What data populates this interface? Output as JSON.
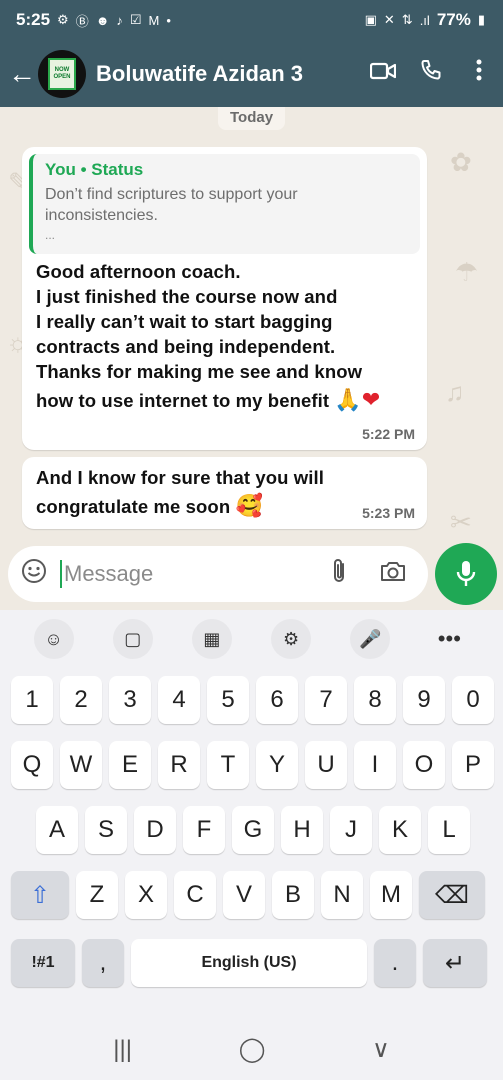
{
  "status_bar": {
    "time": "5:25",
    "left_icons": [
      "⚙",
      "Ⓑ",
      "☻",
      "♪",
      "☑",
      "M",
      "•"
    ],
    "right_icons": [
      "▣",
      "✕",
      "⇅",
      ".ıl"
    ],
    "battery": "77%"
  },
  "header": {
    "contact_name": "Boluwatife Azidan 3",
    "avatar_text": [
      "NOW",
      "OPEN"
    ]
  },
  "chat": {
    "date_divider": "Today",
    "messages": [
      {
        "quote_header": "You • Status",
        "quote_text": "Don’t find scriptures to support your inconsistencies.",
        "quote_more": "...",
        "lines": [
          "Good afternoon coach.",
          "I just finished the course now and",
          "I really can’t wait to start bagging",
          "contracts and being independent.",
          "Thanks for making me see and know",
          "how to use internet to my benefit"
        ],
        "emoji": "🙏",
        "heart": "❤",
        "time": "5:22 PM"
      },
      {
        "lines": [
          "And I know for sure that you will",
          "congratulate me soon"
        ],
        "emoji": "🥰",
        "time": "5:23 PM"
      }
    ]
  },
  "input": {
    "placeholder": "Message"
  },
  "keyboard": {
    "toolbar": [
      "☺",
      "▢",
      "▦",
      "⚙",
      "🎤",
      "•••"
    ],
    "number_row": [
      "1",
      "2",
      "3",
      "4",
      "5",
      "6",
      "7",
      "8",
      "9",
      "0"
    ],
    "row1": [
      "Q",
      "W",
      "E",
      "R",
      "T",
      "Y",
      "U",
      "I",
      "O",
      "P"
    ],
    "row2": [
      "A",
      "S",
      "D",
      "F",
      "G",
      "H",
      "J",
      "K",
      "L"
    ],
    "row3": [
      "Z",
      "X",
      "C",
      "V",
      "B",
      "N",
      "M"
    ],
    "symbols_key": "!#1",
    "comma_key": ",",
    "space_key": "English (US)",
    "period_key": ".",
    "shift_glyph": "⇧",
    "backspace_glyph": "⌫",
    "enter_glyph": "↵"
  },
  "nav": [
    "|||",
    "◯",
    "∨"
  ],
  "colors": {
    "header": "#3d5a66",
    "accent": "#1fa855",
    "chat_bg": "#efeae2"
  }
}
